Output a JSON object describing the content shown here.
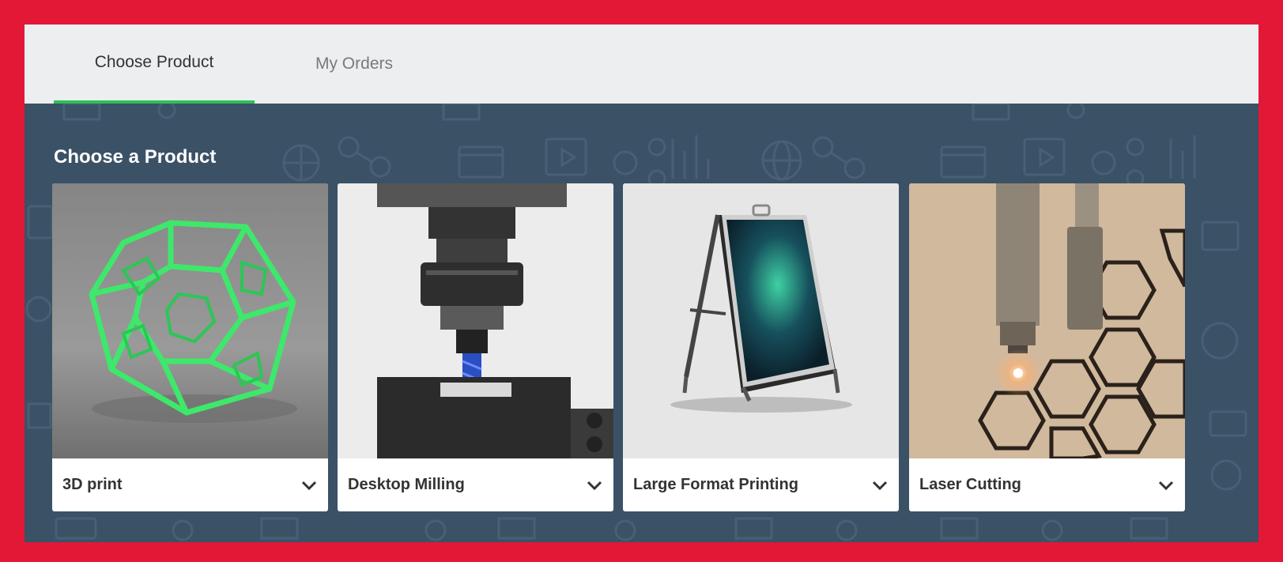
{
  "tabs": [
    {
      "label": "Choose Product",
      "active": true
    },
    {
      "label": "My Orders",
      "active": false
    }
  ],
  "section_title": "Choose a Product",
  "products": [
    {
      "label": "3D print",
      "icon": "chevron-down-icon"
    },
    {
      "label": "Desktop Milling",
      "icon": "chevron-down-icon"
    },
    {
      "label": "Large Format Printing",
      "icon": "chevron-down-icon"
    },
    {
      "label": "Laser Cutting",
      "icon": "chevron-down-icon"
    }
  ],
  "colors": {
    "frame_border": "#e31837",
    "content_bg": "#3b5166",
    "tabbar_bg": "#eceef0",
    "active_tab_underline": "#2fbf5a",
    "card_bg": "#ffffff"
  }
}
